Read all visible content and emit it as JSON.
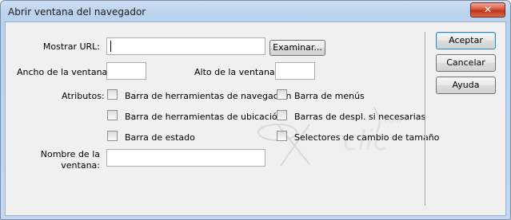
{
  "window": {
    "title": "Abrir ventana del navegador",
    "close_glyph": "✕"
  },
  "form": {
    "url_label": "Mostrar URL:",
    "url_value": "",
    "browse_label": "Examinar...",
    "width_label": "Ancho de la ventana:",
    "width_value": "",
    "height_label": "Alto de la ventana:",
    "height_value": "",
    "attributes_label": "Atributos:",
    "name_label_line1": "Nombre de la",
    "name_label_line2": "ventana:",
    "name_value": ""
  },
  "attributes": [
    {
      "label": "Barra de herramientas de navegación",
      "checked": false
    },
    {
      "label": "Barra de menús",
      "checked": false
    },
    {
      "label": "Barra de herramientas de ubicación",
      "checked": false
    },
    {
      "label": "Barras de despl. si necesarias",
      "checked": false
    },
    {
      "label": "Barra de estado",
      "checked": false
    },
    {
      "label": "Selectores de cambio de tamaño",
      "checked": false
    }
  ],
  "buttons": {
    "ok": "Aceptar",
    "cancel": "Cancelar",
    "help": "Ayuda"
  },
  "watermark": {
    "text": "clic",
    "suffix": ".com"
  },
  "colors": {
    "close_red": "#c0341a",
    "title_bar": "#bcd3ee",
    "client_bg": "#f0f0f0"
  }
}
